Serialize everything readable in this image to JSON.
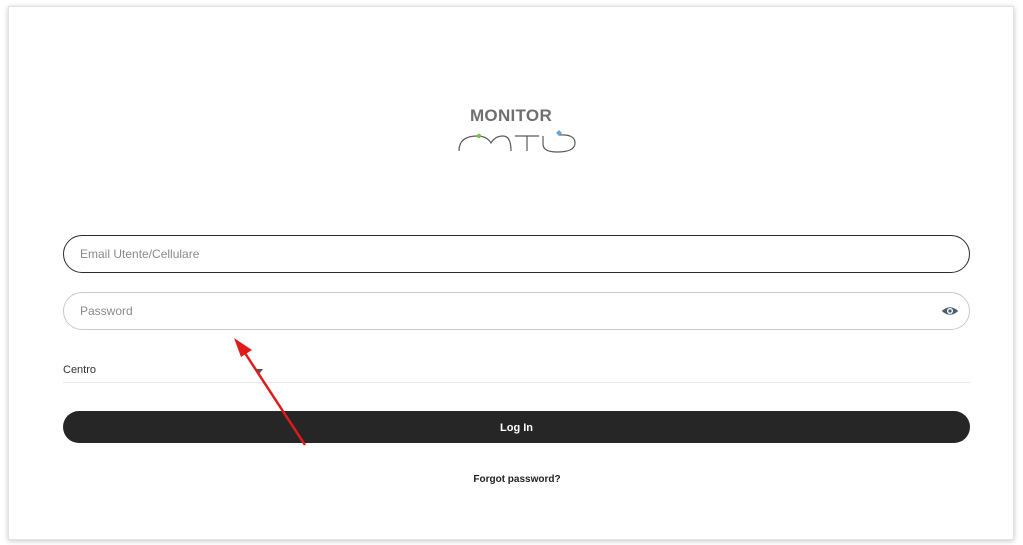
{
  "brand": {
    "title": "MONITOR",
    "logo_icon": "mto-logo-icon",
    "logo_accents": {
      "left_dot": "#7cbf4a",
      "right_dot": "#6aa3d6"
    }
  },
  "form": {
    "email": {
      "placeholder": "Email Utente/Cellulare",
      "value": ""
    },
    "password": {
      "placeholder": "Password",
      "value": "",
      "toggle_icon": "eye-icon"
    },
    "centro": {
      "label": "Centro",
      "icon": "chevron-down-icon"
    },
    "login_label": "Log In",
    "forgot_label": "Forgot password?"
  },
  "annotation": {
    "icon": "red-arrow-annotation",
    "color": "#e01b1b"
  },
  "colors": {
    "button_bg": "#262626",
    "button_text": "#ffffff",
    "active_border": "#2b2b2b",
    "inactive_border": "#c9c9c9",
    "eye_icon": "#4a5f6e"
  }
}
